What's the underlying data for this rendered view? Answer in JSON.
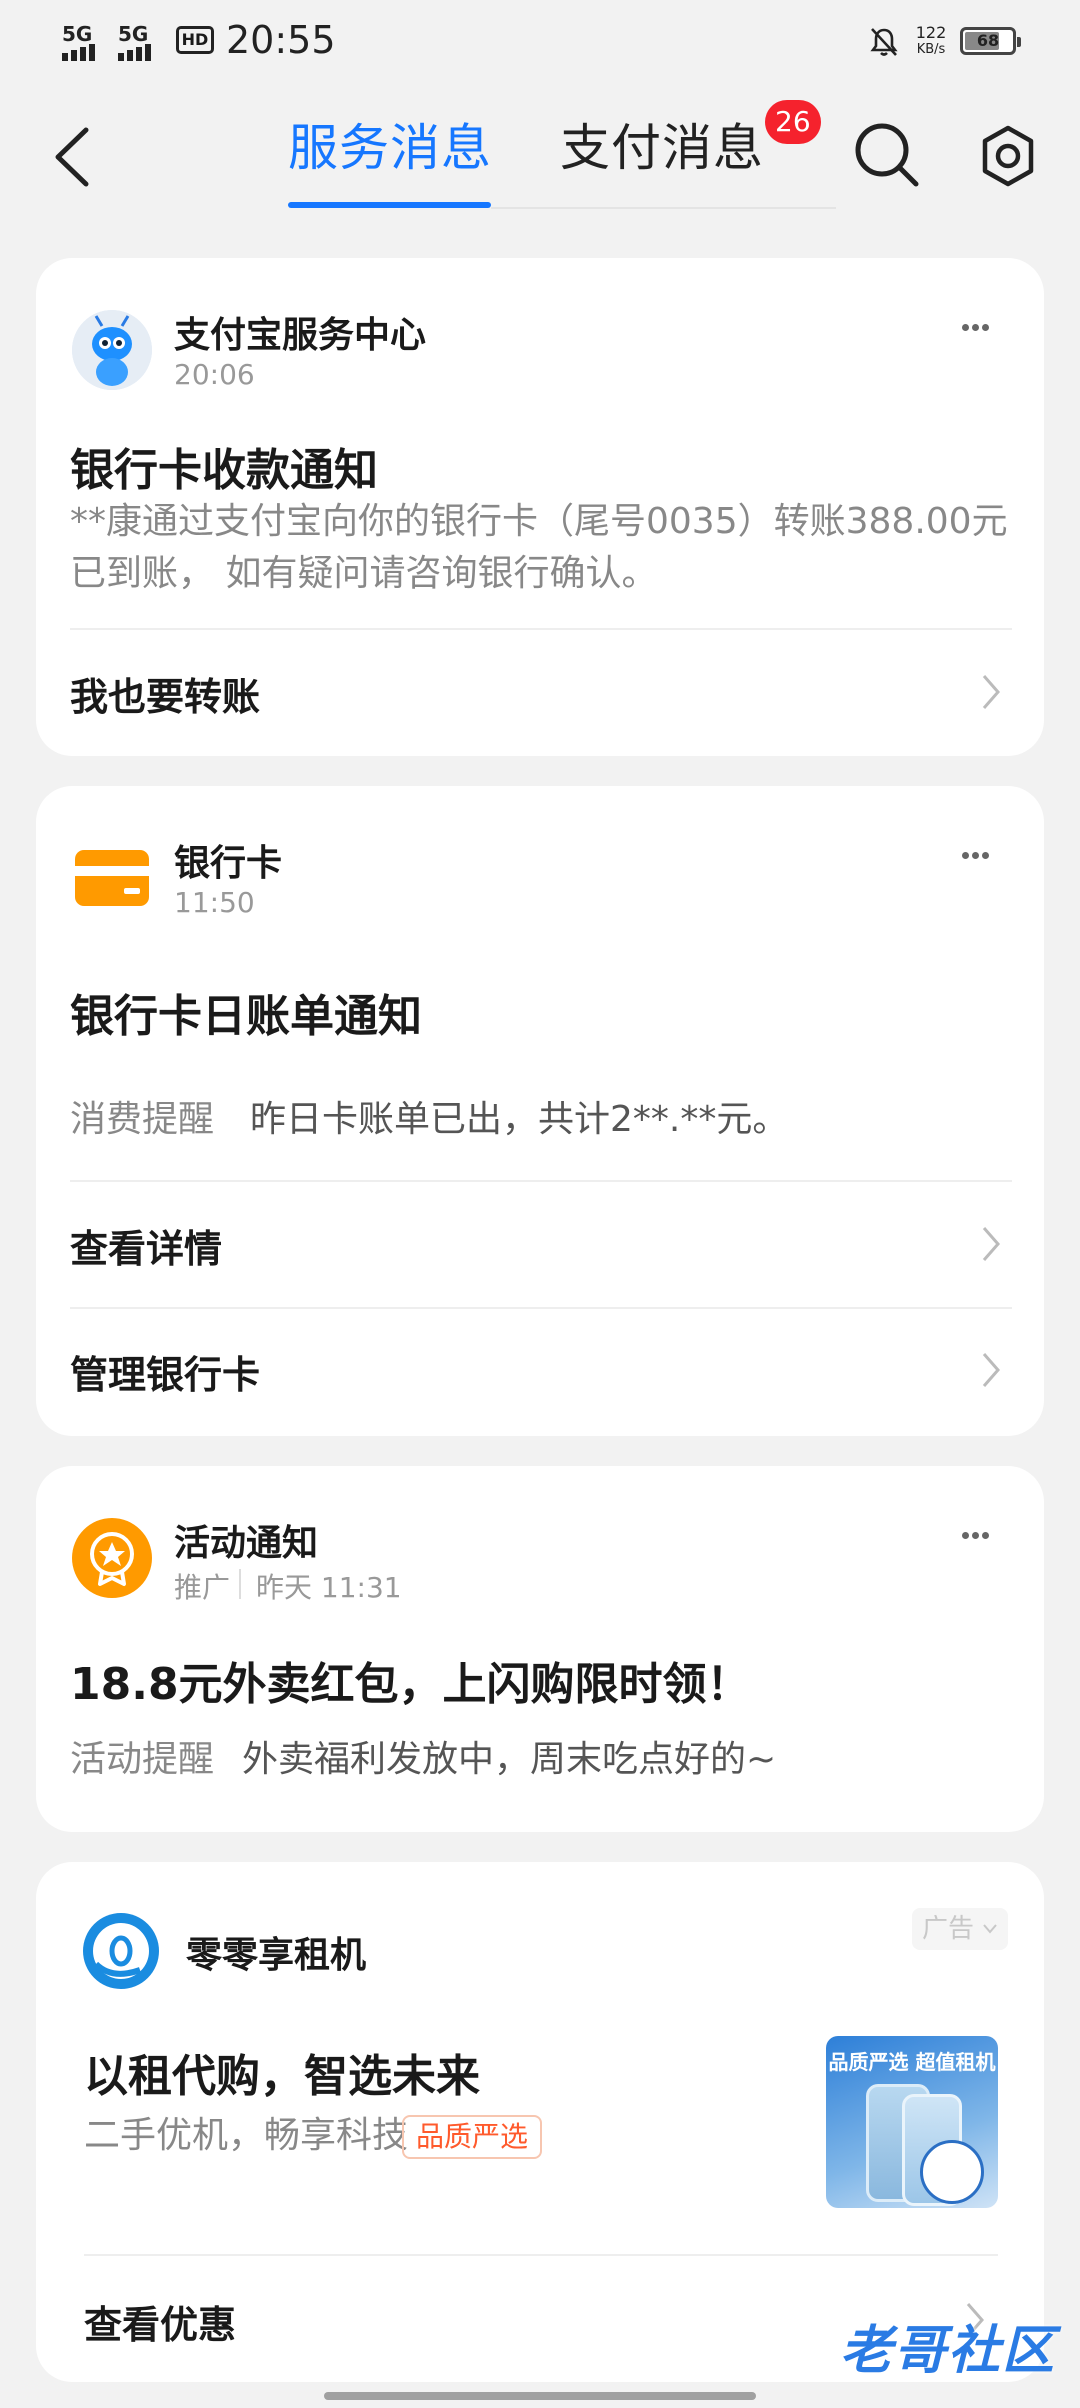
{
  "status_bar": {
    "net1": "5G",
    "net2": "5G",
    "hd": "HD",
    "time": "20:55",
    "speed_value": "122",
    "speed_unit": "KB/s",
    "battery": "68",
    "icons": [
      "signal-icon",
      "signal-icon",
      "hd-icon",
      "mute-bell-icon",
      "battery-icon"
    ]
  },
  "nav": {
    "tabs": [
      {
        "label": "服务消息",
        "active": true
      },
      {
        "label": "支付消息",
        "active": false
      }
    ],
    "badge": "26",
    "icons": [
      "back-icon",
      "search-icon",
      "gear-icon"
    ]
  },
  "cards": [
    {
      "sender": "支付宝服务中心",
      "time": "20:06",
      "headline": "银行卡收款通知",
      "body": "**康通过支付宝向你的银行卡（尾号0035）转账388.00元已到账， 如有疑问请咨询银行确认。",
      "actions": [
        "我也要转账"
      ]
    },
    {
      "sender": "银行卡",
      "time": "11:50",
      "headline": "银行卡日账单通知",
      "body_label": "消费提醒",
      "body": "昨日卡账单已出，共计2**.**元。",
      "actions": [
        "查看详情",
        "管理银行卡"
      ]
    },
    {
      "sender": "活动通知",
      "tag": "推广",
      "time": "昨天 11:31",
      "headline": "18.8元外卖红包，上闪购限时领！",
      "body_label": "活动提醒",
      "body": "外卖福利发放中，周末吃点好的~"
    },
    {
      "sender": "零零享租机",
      "ad_label": "广告",
      "headline": "以租代购，智选未来",
      "body": "二手优机，畅享科技",
      "quality_tag": "品质严选",
      "promo_text": "品质严选 超值租机",
      "actions": [
        "查看优惠"
      ]
    }
  ],
  "watermark": "老哥社区",
  "colors": {
    "accent": "#1677ff",
    "badge": "#f5222d",
    "card_icon": "#ff9a00"
  }
}
